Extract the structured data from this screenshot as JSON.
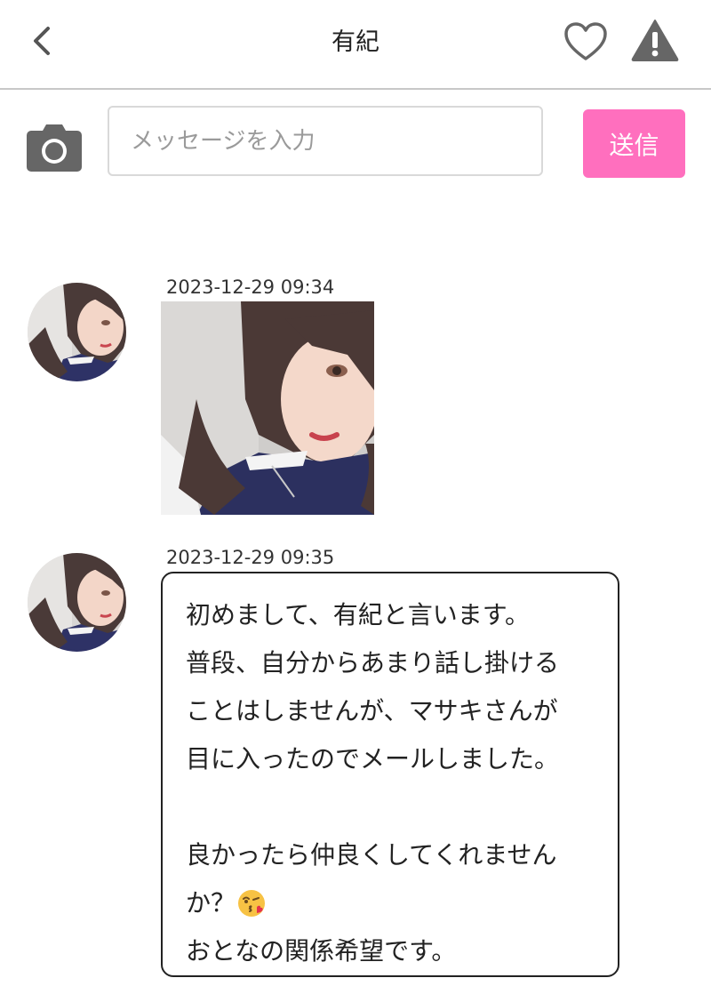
{
  "header": {
    "title": "有紀",
    "icons": {
      "back": "chevron-left-icon",
      "favorite": "heart-outline-icon",
      "report": "warning-triangle-icon"
    }
  },
  "composer": {
    "camera_icon": "camera-icon",
    "input_placeholder": "メッセージを入力",
    "input_value": "",
    "send_label": "送信",
    "send_color": "#ff6fbe"
  },
  "messages": [
    {
      "timestamp": "2023-12-29 09:34",
      "type": "image",
      "image": "selfie-photo"
    },
    {
      "timestamp": "2023-12-29 09:35",
      "type": "text",
      "lines": [
        "初めまして、有紀と言います。",
        "普段、自分からあまり話し掛ける",
        "ことはしませんが、マサキさんが",
        "目に入ったのでメールしました。",
        "",
        "良かったら仲良くしてくれません",
        "か？",
        "おとなの関係希望です。"
      ],
      "emoji": "kissing-face-emoji"
    }
  ]
}
